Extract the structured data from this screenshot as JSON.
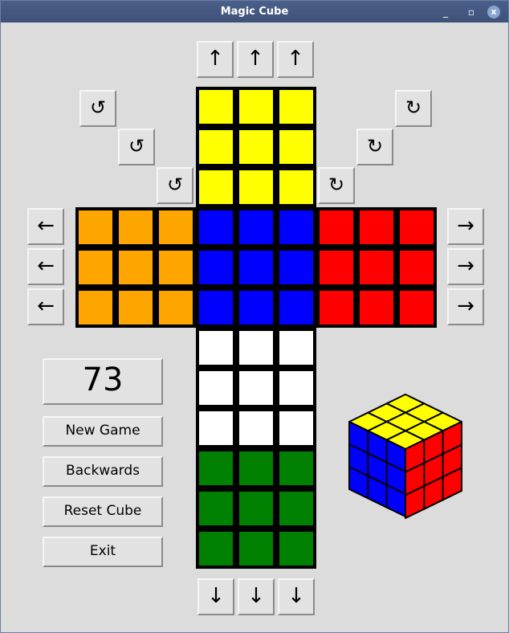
{
  "window": {
    "title": "Magic Cube",
    "minimize_glyph": "_",
    "maximize_glyph": "▫",
    "close_glyph": "x"
  },
  "arrows": {
    "up": "↑",
    "down": "↓",
    "left": "←",
    "right": "→",
    "ccw": "↺",
    "cw": "↻"
  },
  "score": "73",
  "menu": {
    "new_game": "New Game",
    "backwards": "Backwards",
    "reset": "Reset Cube",
    "exit": "Exit"
  },
  "colors": {
    "yellow": "#ffff00",
    "blue": "#0000ff",
    "red": "#ff0000",
    "orange": "#ffa500",
    "white": "#ffffff",
    "green": "#008000"
  },
  "cube": {
    "top": [
      [
        "yellow",
        "yellow",
        "yellow"
      ],
      [
        "yellow",
        "yellow",
        "yellow"
      ],
      [
        "yellow",
        "yellow",
        "yellow"
      ]
    ],
    "left": [
      [
        "orange",
        "orange",
        "orange"
      ],
      [
        "orange",
        "orange",
        "orange"
      ],
      [
        "orange",
        "orange",
        "orange"
      ]
    ],
    "front": [
      [
        "blue",
        "blue",
        "blue"
      ],
      [
        "blue",
        "blue",
        "blue"
      ],
      [
        "blue",
        "blue",
        "blue"
      ]
    ],
    "right": [
      [
        "red",
        "red",
        "red"
      ],
      [
        "red",
        "red",
        "red"
      ],
      [
        "red",
        "red",
        "red"
      ]
    ],
    "bottom": [
      [
        "white",
        "white",
        "white"
      ],
      [
        "white",
        "white",
        "white"
      ],
      [
        "white",
        "white",
        "white"
      ]
    ],
    "back": [
      [
        "green",
        "green",
        "green"
      ],
      [
        "green",
        "green",
        "green"
      ],
      [
        "green",
        "green",
        "green"
      ]
    ]
  },
  "preview": {
    "top": "yellow",
    "left": "blue",
    "right": "red"
  }
}
